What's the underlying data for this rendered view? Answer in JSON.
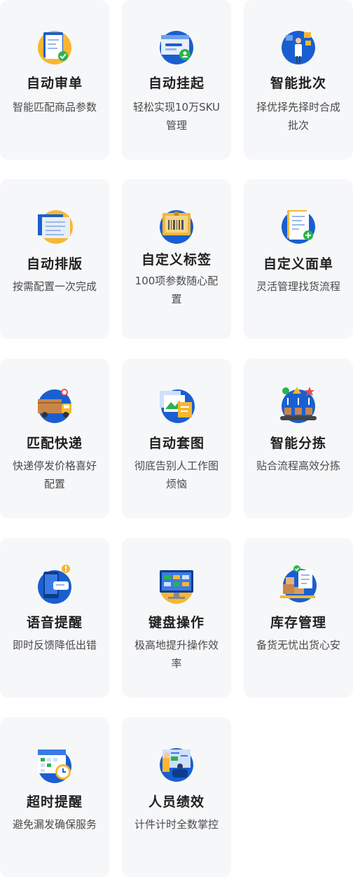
{
  "features": [
    {
      "title": "自动审单",
      "desc": "智能匹配商品参数",
      "icon": "order-review-icon"
    },
    {
      "title": "自动挂起",
      "desc": "轻松实现10万SKU管理",
      "icon": "suspend-icon"
    },
    {
      "title": "智能批次",
      "desc": "择优择先择时合成批次",
      "icon": "batch-icon"
    },
    {
      "title": "自动排版",
      "desc": "按需配置一次完成",
      "icon": "layout-icon"
    },
    {
      "title": "自定义标签",
      "desc": "100项参数随心配置",
      "icon": "label-icon"
    },
    {
      "title": "自定义面单",
      "desc": "灵活管理找货流程",
      "icon": "waybill-icon"
    },
    {
      "title": "匹配快递",
      "desc": "快递停发价格喜好配置",
      "icon": "delivery-truck-icon"
    },
    {
      "title": "自动套图",
      "desc": "彻底告别人工作图烦恼",
      "icon": "image-set-icon"
    },
    {
      "title": "智能分拣",
      "desc": "贴合流程高效分拣",
      "icon": "sorting-icon"
    },
    {
      "title": "语音提醒",
      "desc": "即时反馈降低出错",
      "icon": "voice-alert-icon"
    },
    {
      "title": "键盘操作",
      "desc": "极高地提升操作效率",
      "icon": "keyboard-monitor-icon"
    },
    {
      "title": "库存管理",
      "desc": "备货无忧出货心安",
      "icon": "inventory-icon"
    },
    {
      "title": "超时提醒",
      "desc": "避免漏发确保服务",
      "icon": "calendar-clock-icon"
    },
    {
      "title": "人员绩效",
      "desc": "计件计时全数掌控",
      "icon": "staff-performance-icon"
    }
  ],
  "colors": {
    "card_bg": "#f6f7f9",
    "accent_blue": "#1a5fd0",
    "accent_yellow": "#f7b731",
    "title": "#1f1f1f",
    "desc": "#4a4a4a"
  }
}
